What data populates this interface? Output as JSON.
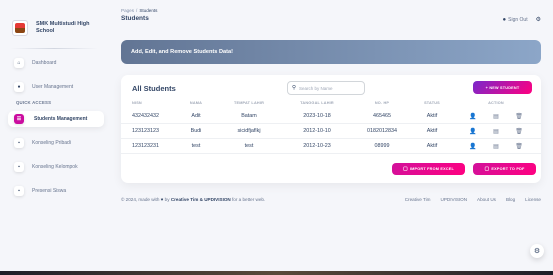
{
  "sidebar": {
    "brand": "SMK Multistudi High School",
    "items": [
      {
        "label": "Dashboard",
        "icon": "home-icon"
      },
      {
        "label": "User Management",
        "icon": "user-icon"
      }
    ],
    "section_label": "QUICK ACCESS",
    "quick": [
      {
        "label": "Students Management",
        "icon": "list-icon",
        "active": true
      },
      {
        "label": "Konseling Pribadi",
        "icon": "chat-icon"
      },
      {
        "label": "Konseling Kelompok",
        "icon": "group-icon"
      },
      {
        "label": "Presensi Siswa",
        "icon": "attendance-icon"
      }
    ]
  },
  "header": {
    "breadcrumb_root": "Pages",
    "breadcrumb_current": "Students",
    "title": "Students",
    "sign_out": "Sign Out"
  },
  "banner": {
    "text": "Add, Edit, and Remove Students Data!"
  },
  "card": {
    "title": "All Students",
    "search_placeholder": "Search by Name",
    "new_button": "+ NEW STUDENT",
    "columns": [
      "NISN",
      "NAMA",
      "TEMPAT LAHIR",
      "TANGGAL LAHIR",
      "NO. HP",
      "STATUS",
      "ACTION"
    ],
    "rows": [
      {
        "nisn": "432432432",
        "nama": "Adit",
        "tempat": "Batam",
        "tanggal": "2023-10-18",
        "hp": "465465",
        "status": "Aktif"
      },
      {
        "nisn": "123123123",
        "nama": "Budi",
        "tempat": "sicidfjaflkj",
        "tanggal": "2012-10-10",
        "hp": "0182012834",
        "status": "Aktif"
      },
      {
        "nisn": "123123231",
        "nama": "test",
        "tempat": "test",
        "tanggal": "2012-10-23",
        "hp": "08999",
        "status": "Aktif"
      }
    ],
    "import_button": "IMPORT FROM EXCEL",
    "export_button": "EXPORT TO PDF"
  },
  "footer": {
    "copyright_prefix": "© 2024, made with",
    "by": "by",
    "creative_tim": "Creative Tim",
    "and": "&",
    "updivision": "UPDIVISION",
    "suffix": "for a better web.",
    "links": [
      "Creative Tim",
      "UPDIVISION",
      "About Us",
      "Blog",
      "License"
    ]
  },
  "colors": {
    "accent": "#cb0c9f",
    "banner_start": "#627594",
    "banner_end": "#8ca6c8"
  }
}
